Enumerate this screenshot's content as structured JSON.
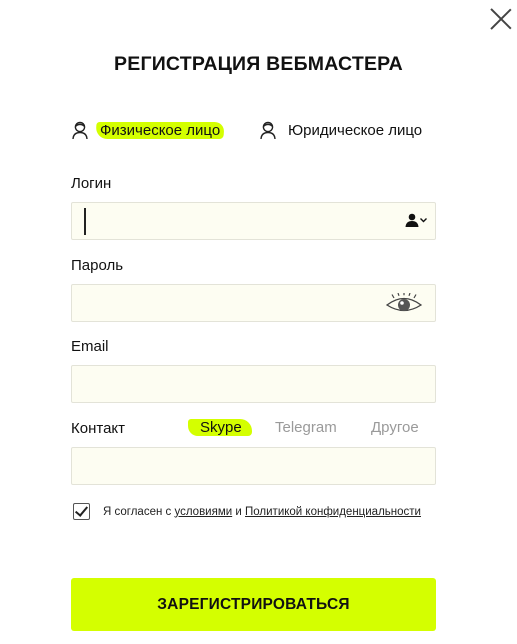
{
  "dialog": {
    "title": "РЕГИСТРАЦИЯ ВЕБМАСТЕРА"
  },
  "account_type": {
    "options": [
      {
        "label": "Физическое лицо",
        "selected": true
      },
      {
        "label": "Юридическое лицо",
        "selected": false
      }
    ]
  },
  "fields": {
    "login": {
      "label": "Логин",
      "value": ""
    },
    "password": {
      "label": "Пароль",
      "value": ""
    },
    "email": {
      "label": "Email",
      "value": ""
    },
    "contact": {
      "label": "Контакт",
      "value": "",
      "options": [
        {
          "label": "Skype",
          "selected": true
        },
        {
          "label": "Telegram",
          "selected": false
        },
        {
          "label": "Другое",
          "selected": false
        }
      ]
    }
  },
  "agreement": {
    "checked": true,
    "text_before": "Я согласен с",
    "terms_link": "условиями",
    "conjunction": "и",
    "privacy_link": "Политикой конфиденциальности"
  },
  "submit_label": "ЗАРЕГИСТРИРОВАТЬСЯ",
  "colors": {
    "accent": "#d4ff00",
    "field_bg": "#fdfdf2",
    "inactive_text": "#9a9a9a"
  },
  "icons": [
    "close-icon",
    "person-icon",
    "user-icon",
    "chevron-down-icon",
    "eye-icon",
    "checkmark-icon"
  ]
}
